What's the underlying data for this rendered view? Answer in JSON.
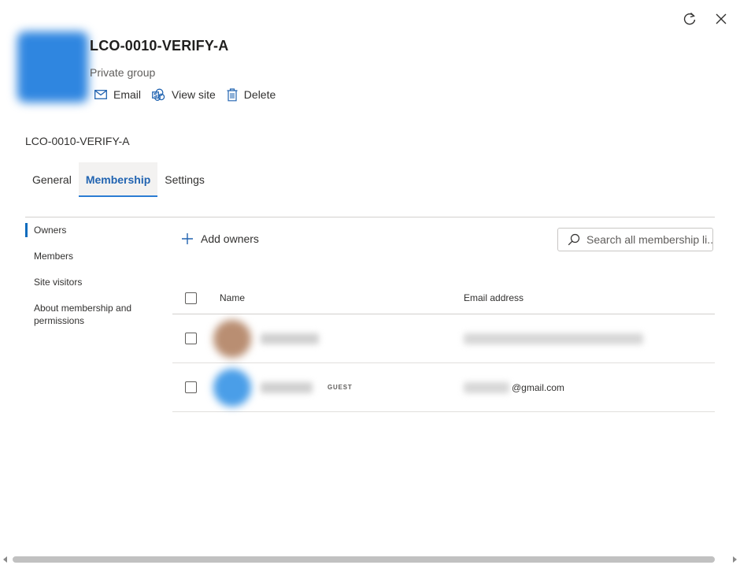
{
  "group": {
    "title": "LCO-0010-VERIFY-A",
    "privacy": "Private group",
    "actions": {
      "email": "Email",
      "view_site": "View site",
      "delete": "Delete"
    }
  },
  "breadcrumb": "LCO-0010-VERIFY-A",
  "tabs": [
    {
      "label": "General"
    },
    {
      "label": "Membership"
    },
    {
      "label": "Settings"
    }
  ],
  "active_tab": "Membership",
  "leftnav": [
    {
      "label": "Owners"
    },
    {
      "label": "Members"
    },
    {
      "label": "Site visitors"
    },
    {
      "label": "About membership and permissions"
    }
  ],
  "active_nav": "Owners",
  "commands": {
    "add_owners": "Add owners",
    "search_placeholder": "Search all membership li..."
  },
  "table": {
    "headers": {
      "name": "Name",
      "email": "Email address"
    },
    "rows": [
      {
        "badge": "",
        "email_visible": ""
      },
      {
        "badge": "GUEST",
        "email_visible": "@gmail.com"
      }
    ]
  },
  "icons": {
    "refresh": "refresh-icon",
    "close": "close-icon",
    "mail": "mail-icon",
    "sharepoint": "sharepoint-icon",
    "trash": "trash-icon",
    "plus": "plus-icon",
    "search": "search-icon"
  },
  "colors": {
    "accent": "#2264b1",
    "tab_underline": "#2b7cd3",
    "group_avatar": "#2f86e0",
    "owner1_avatar": "#b98e72",
    "owner2_avatar": "#4a9ee8"
  }
}
